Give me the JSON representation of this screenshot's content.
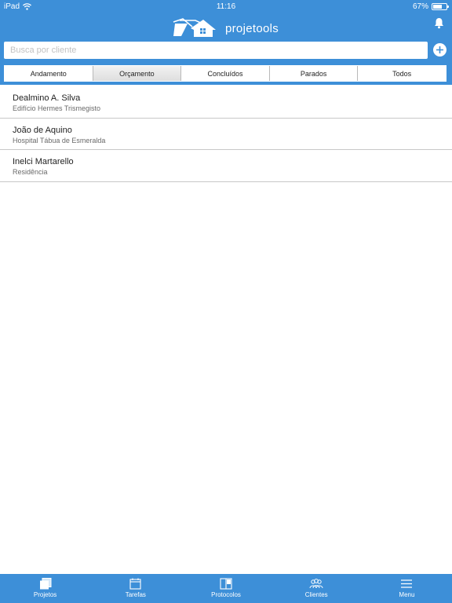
{
  "status_bar": {
    "device": "iPad",
    "time": "11:16",
    "battery": "67%",
    "battery_level": 0.67
  },
  "header": {
    "app_name": "projetools"
  },
  "search": {
    "placeholder": "Busca por cliente",
    "value": ""
  },
  "tabs": [
    {
      "label": "Andamento",
      "active": false
    },
    {
      "label": "Orçamento",
      "active": true
    },
    {
      "label": "Concluídos",
      "active": false
    },
    {
      "label": "Parados",
      "active": false
    },
    {
      "label": "Todos",
      "active": false
    }
  ],
  "projects": [
    {
      "client": "Dealmino A. Silva",
      "project": "Edifício Hermes Trismegisto"
    },
    {
      "client": "João de Aquino",
      "project": "Hospital Tábua de Esmeralda"
    },
    {
      "client": "Inelci Martarello",
      "project": "Residência"
    }
  ],
  "tabbar": [
    {
      "label": "Projetos",
      "icon": "projects-icon"
    },
    {
      "label": "Tarefas",
      "icon": "calendar-icon"
    },
    {
      "label": "Protocolos",
      "icon": "book-icon"
    },
    {
      "label": "Clientes",
      "icon": "clients-icon"
    },
    {
      "label": "Menu",
      "icon": "menu-icon"
    }
  ],
  "colors": {
    "brand": "#3d8fd8",
    "surface": "#ffffff",
    "divider": "#c8c8c8"
  }
}
